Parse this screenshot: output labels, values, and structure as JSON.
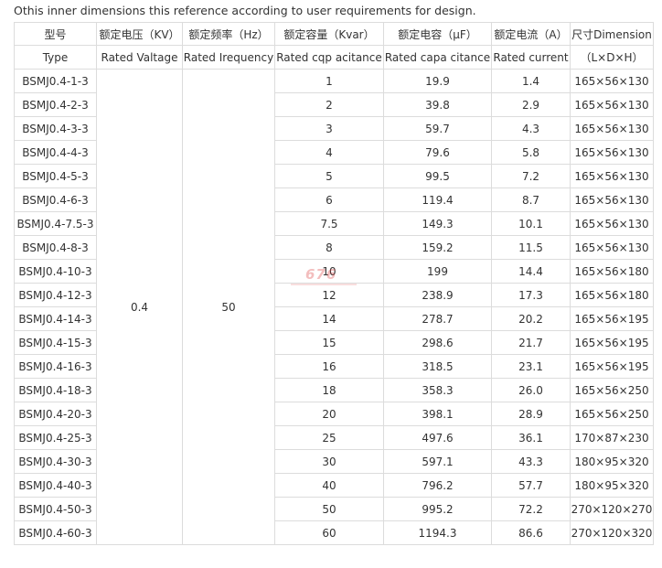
{
  "caption": "Othis inner dimensions this reference according to user requirements for design.",
  "headers": {
    "cn": [
      "型号",
      "额定电压（KV）",
      "额定频率（Hz）",
      "额定容量（Kvar）",
      "额定电容（μF）",
      "额定电流（A）",
      "尺寸Dimension"
    ],
    "en": [
      "Type",
      "Rated Valtage",
      "Rated Irequency",
      "Rated cqp acitance",
      "Rated capa citance",
      "Rated current",
      "（L×D×H）"
    ]
  },
  "shared": {
    "voltage": "0.4",
    "frequency": "50"
  },
  "rows": [
    {
      "type": "BSMJ0.4-1-3",
      "capacity": "1",
      "capacitance": "19.9",
      "current": "1.4",
      "dimension": "165×56×130"
    },
    {
      "type": "BSMJ0.4-2-3",
      "capacity": "2",
      "capacitance": "39.8",
      "current": "2.9",
      "dimension": "165×56×130"
    },
    {
      "type": "BSMJ0.4-3-3",
      "capacity": "3",
      "capacitance": "59.7",
      "current": "4.3",
      "dimension": "165×56×130"
    },
    {
      "type": "BSMJ0.4-4-3",
      "capacity": "4",
      "capacitance": "79.6",
      "current": "5.8",
      "dimension": "165×56×130"
    },
    {
      "type": "BSMJ0.4-5-3",
      "capacity": "5",
      "capacitance": "99.5",
      "current": "7.2",
      "dimension": "165×56×130"
    },
    {
      "type": "BSMJ0.4-6-3",
      "capacity": "6",
      "capacitance": "119.4",
      "current": "8.7",
      "dimension": "165×56×130"
    },
    {
      "type": "BSMJ0.4-7.5-3",
      "capacity": "7.5",
      "capacitance": "149.3",
      "current": "10.1",
      "dimension": "165×56×130"
    },
    {
      "type": "BSMJ0.4-8-3",
      "capacity": "8",
      "capacitance": "159.2",
      "current": "11.5",
      "dimension": "165×56×130"
    },
    {
      "type": "BSMJ0.4-10-3",
      "capacity": "10",
      "capacitance": "199",
      "current": "14.4",
      "dimension": "165×56×180"
    },
    {
      "type": "BSMJ0.4-12-3",
      "capacity": "12",
      "capacitance": "238.9",
      "current": "17.3",
      "dimension": "165×56×180"
    },
    {
      "type": "BSMJ0.4-14-3",
      "capacity": "14",
      "capacitance": "278.7",
      "current": "20.2",
      "dimension": "165×56×195"
    },
    {
      "type": "BSMJ0.4-15-3",
      "capacity": "15",
      "capacitance": "298.6",
      "current": "21.7",
      "dimension": "165×56×195"
    },
    {
      "type": "BSMJ0.4-16-3",
      "capacity": "16",
      "capacitance": "318.5",
      "current": "23.1",
      "dimension": "165×56×195"
    },
    {
      "type": "BSMJ0.4-18-3",
      "capacity": "18",
      "capacitance": "358.3",
      "current": "26.0",
      "dimension": "165×56×250"
    },
    {
      "type": "BSMJ0.4-20-3",
      "capacity": "20",
      "capacitance": "398.1",
      "current": "28.9",
      "dimension": "165×56×250"
    },
    {
      "type": "BSMJ0.4-25-3",
      "capacity": "25",
      "capacitance": "497.6",
      "current": "36.1",
      "dimension": "170×87×230"
    },
    {
      "type": "BSMJ0.4-30-3",
      "capacity": "30",
      "capacitance": "597.1",
      "current": "43.3",
      "dimension": "180×95×320"
    },
    {
      "type": "BSMJ0.4-40-3",
      "capacity": "40",
      "capacitance": "796.2",
      "current": "57.7",
      "dimension": "180×95×320"
    },
    {
      "type": "BSMJ0.4-50-3",
      "capacity": "50",
      "capacitance": "995.2",
      "current": "72.2",
      "dimension": "270×120×270"
    },
    {
      "type": "BSMJ0.4-60-3",
      "capacity": "60",
      "capacitance": "1194.3",
      "current": "86.6",
      "dimension": "270×120×320"
    }
  ],
  "watermark": {
    "text": "676"
  },
  "colors": {
    "text": "#333333",
    "border": "#dcdcdc",
    "background": "#ffffff",
    "watermark": "#dc4646"
  }
}
